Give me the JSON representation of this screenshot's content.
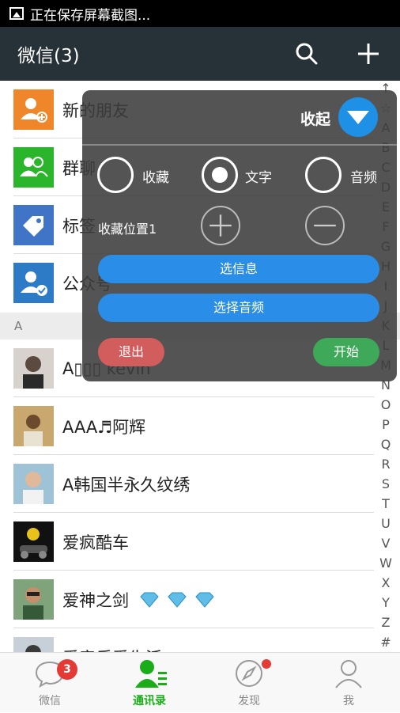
{
  "status_bar": {
    "text": "正在保存屏幕截图...",
    "icon": "image-icon"
  },
  "title_bar": {
    "title": "微信(3)",
    "search_icon": "search-icon",
    "add_icon": "plus-icon"
  },
  "contacts": {
    "fixed": [
      {
        "label": "新的朋友",
        "icon": "add-friend-icon",
        "color": "#f0862a"
      },
      {
        "label": "群聊",
        "icon": "group-icon",
        "color": "#2bb52b"
      },
      {
        "label": "标签",
        "icon": "tag-icon",
        "color": "#3f74c6"
      },
      {
        "label": "公众号",
        "icon": "official-account-icon",
        "color": "#2d7bc7"
      }
    ],
    "section_header": "A",
    "people": [
      {
        "label": "A▯▯▯ kevin"
      },
      {
        "label": "AAA♬阿辉"
      },
      {
        "label": "A韩国半永久纹绣"
      },
      {
        "label": "爱疯酷车"
      },
      {
        "label": "爱神之剑"
      },
      {
        "label": "爱音乐爱生活"
      }
    ]
  },
  "index_letters": [
    "↑",
    "☆",
    "A",
    "B",
    "C",
    "D",
    "E",
    "F",
    "G",
    "H",
    "I",
    "J",
    "K",
    "L",
    "M",
    "N",
    "O",
    "P",
    "Q",
    "R",
    "S",
    "T",
    "U",
    "V",
    "W",
    "X",
    "Y",
    "Z",
    "#"
  ],
  "overlay": {
    "collapse_label": "收起",
    "radios": [
      {
        "label": "收藏",
        "selected": false
      },
      {
        "label": "文字",
        "selected": true
      },
      {
        "label": "音频",
        "selected": false
      }
    ],
    "position_label": "收藏位置1",
    "select_message": "选信息",
    "select_audio": "选择音频",
    "exit": "退出",
    "start": "开始"
  },
  "tabs": [
    {
      "label": "微信",
      "badge": "3",
      "active": false
    },
    {
      "label": "通讯录",
      "active": true
    },
    {
      "label": "发现",
      "has_dot": true,
      "active": false
    },
    {
      "label": "我",
      "active": false
    }
  ],
  "colors": {
    "accent": "#1aad19",
    "header": "#263238",
    "badge": "#e53935",
    "overlay_blue": "#2a8ee8"
  }
}
